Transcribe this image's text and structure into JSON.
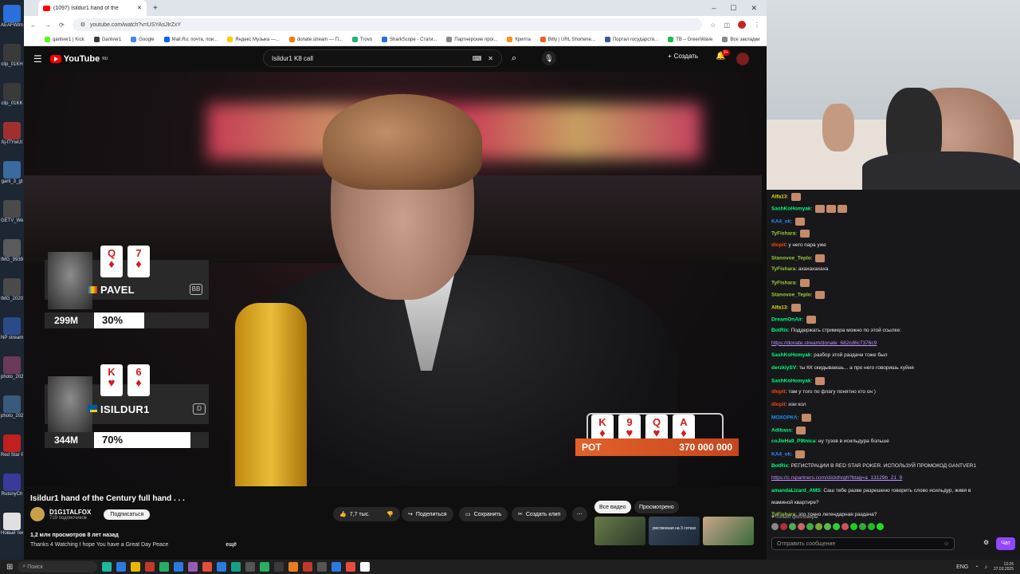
{
  "desktop": {
    "icons": [
      {
        "label": "AEAFWtm"
      },
      {
        "label": "clip_01KH"
      },
      {
        "label": "clip_01KK"
      },
      {
        "label": "fq-f7YwUt"
      },
      {
        "label": "gant_3_gt"
      },
      {
        "label": "GETV_We 2_gantver"
      },
      {
        "label": "IMG_9939"
      },
      {
        "label": "IMG_2020"
      },
      {
        "label": "NP stream gantver1"
      },
      {
        "label": "photo_202"
      },
      {
        "label": "photo_202"
      },
      {
        "label": "Red Star Poker"
      },
      {
        "label": "RutonyCh"
      },
      {
        "label": "Новый текстовый"
      }
    ]
  },
  "browser": {
    "tab_title": "(1097) Isildur1 hand of the",
    "url": "youtube.com/watch?v=USYAsJIrZxY",
    "bookmarks": [
      "gantver1 | Kick",
      "Gantver1",
      "Google",
      "Mail.Ru: почта, пои...",
      "Яндекс Музыка —...",
      "donate.stream — П...",
      "Trovo",
      "SharkScope - Стати...",
      "Партнерские прог...",
      "Крипта",
      "Bitly | URL Shortene...",
      "Портал государств...",
      "TB – GreenWave",
      "Все закладки"
    ]
  },
  "youtube": {
    "logo": "YouTube",
    "logo_region": "RU",
    "search_value": "Isildur1 K8 call",
    "create_label": "Создать",
    "notif_count": "9+",
    "video": {
      "players": [
        {
          "name": "PAVEL",
          "cards": [
            {
              "rank": "Q",
              "suit": "♦"
            },
            {
              "rank": "7",
              "suit": "♦"
            }
          ],
          "stack": "299M",
          "equity": "30%",
          "badge": "BB"
        },
        {
          "name": "ISILDUR1",
          "cards": [
            {
              "rank": "K",
              "suit": "♥"
            },
            {
              "rank": "6",
              "suit": "♦"
            }
          ],
          "stack": "344M",
          "equity": "70%",
          "badge": "D"
        }
      ],
      "board": [
        {
          "rank": "K",
          "suit": "♦"
        },
        {
          "rank": "9",
          "suit": "♥"
        },
        {
          "rank": "Q",
          "suit": "♥"
        },
        {
          "rank": "A",
          "suit": "♦"
        }
      ],
      "pot_label": "POT",
      "pot_value": "370 000 000"
    },
    "title": "Isildur1 hand of the Century full hand . . .",
    "channel": {
      "name": "D1G1TALFOX",
      "subs": "719 подписчиков",
      "subscribe_label": "Подписаться"
    },
    "actions": {
      "likes": "7,7 тыс.",
      "share": "Поделиться",
      "save": "Сохранить",
      "clip": "Создать клип"
    },
    "stats": "1,2 млн просмотров  8 лет назад",
    "description": "Thanks 4 Watching I hope You have a Great Day Peace",
    "more": "ещё",
    "chips": [
      "Все видео",
      "Просмотрено"
    ],
    "thumb_caption": "умственная на 3 сотках"
  },
  "chat": {
    "messages": [
      {
        "user": "Alfa13",
        "color": "#e0e000",
        "text": "",
        "emotes": 1
      },
      {
        "user": "SashKoHomyak",
        "color": "#00ff7f",
        "text": "",
        "emotes": 3
      },
      {
        "user": "KA4_ok",
        "color": "#1e90ff",
        "text": "",
        "emotes": 1
      },
      {
        "user": "TyFishara",
        "color": "#9acd32",
        "text": "",
        "emotes": 1
      },
      {
        "user": "dlopit",
        "color": "#ff4500",
        "text": "у него пара уже",
        "emotes": 0
      },
      {
        "user": "Stanovoe_Teplo",
        "color": "#9acd32",
        "text": "",
        "emotes": 1
      },
      {
        "user": "TyFishara",
        "color": "#9acd32",
        "text": "ахахахахаха",
        "emotes": 0
      },
      {
        "user": "TyFishara",
        "color": "#9acd32",
        "text": "",
        "emotes": 1
      },
      {
        "user": "Stanovoe_Teplo",
        "color": "#9acd32",
        "text": "",
        "emotes": 1
      },
      {
        "user": "Alfa13",
        "color": "#e0e000",
        "text": "",
        "emotes": 1
      },
      {
        "user": "DreamOnAir",
        "color": "#00ff7f",
        "text": "",
        "emotes": 1
      },
      {
        "user": "BotRix",
        "color": "#00ff7f",
        "text": "Поддержать стримера можно по этой ссылке:",
        "emotes": 0
      },
      {
        "user": "",
        "color": "#fff",
        "text": "https://donate.stream/donate_682cd6c7376c9",
        "emotes": 0
      },
      {
        "user": "SashKoHomyak",
        "color": "#00ff7f",
        "text": "разбор этой раздачи тоже был",
        "emotes": 0
      },
      {
        "user": "derzkiySV",
        "color": "#00ff7f",
        "text": "ты КК скидываешь... а про него говоришь хуйня",
        "emotes": 0
      },
      {
        "user": "SashKoHomyak",
        "color": "#00ff7f",
        "text": "",
        "emotes": 1
      },
      {
        "user": "dlopit",
        "color": "#ff4500",
        "text": "там у того по флагу понятно кто он )",
        "emotes": 0
      },
      {
        "user": "dlopit",
        "color": "#ff4500",
        "text": "изи кол",
        "emotes": 0
      },
      {
        "user": "МОХОРКА",
        "color": "#1e90ff",
        "text": "",
        "emotes": 1
      },
      {
        "user": "Adibass",
        "color": "#00ff7f",
        "text": "",
        "emotes": 1
      },
      {
        "user": "coJleHa9_P9tnica",
        "color": "#00ff7f",
        "text": "ну тузов в исильдура больше",
        "emotes": 0
      },
      {
        "user": "KA4_ok",
        "color": "#1e90ff",
        "text": "",
        "emotes": 1
      },
      {
        "user": "BotRix",
        "color": "#00ff7f",
        "text": "РЕГИСТРАЦИИ В RED STAR POKER. ИСПОЛЬЗУЙ ПРОМОКОД GANTVER1",
        "emotes": 0
      },
      {
        "user": "",
        "color": "#fff",
        "text": "https://c.rspartners.com/clickthrgh?btag=a_13129b_21_9",
        "emotes": 0
      },
      {
        "user": "amandaLizard_AMS",
        "color": "#00ff7f",
        "text": "Саш тебе разве разрешено говорить слово исильдур, живя в",
        "emotes": 0
      },
      {
        "user": "",
        "color": "#fff",
        "text": "маминой квартире?",
        "emotes": 0
      },
      {
        "user": "TyFishara",
        "color": "#9acd32",
        "text": "это точно легендарная раздача?",
        "emotes": 0
      }
    ],
    "followers_only": "Только фолловеры",
    "input_placeholder": "Отправить сообщение",
    "send_label": "Чат"
  },
  "taskbar": {
    "search": "Поиск",
    "lang": "ENG",
    "time": "13:26",
    "date": "27.03.2025"
  }
}
